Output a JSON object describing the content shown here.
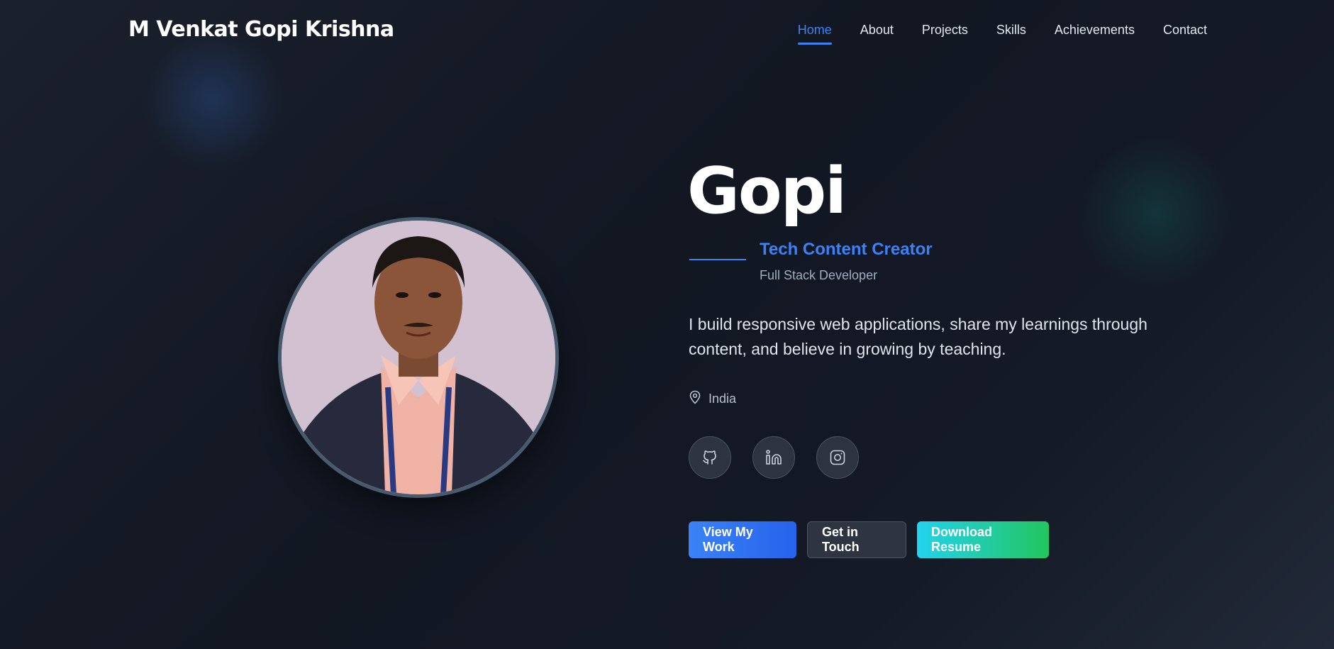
{
  "nav": {
    "brand": "M Venkat Gopi Krishna",
    "links": [
      {
        "label": "Home",
        "active": true
      },
      {
        "label": "About",
        "active": false
      },
      {
        "label": "Projects",
        "active": false
      },
      {
        "label": "Skills",
        "active": false
      },
      {
        "label": "Achievements",
        "active": false
      },
      {
        "label": "Contact",
        "active": false
      }
    ]
  },
  "hero": {
    "name": "Gopi",
    "role_primary": "Tech Content Creator",
    "role_secondary": "Full Stack Developer",
    "bio": "I build responsive web applications, share my learnings through content, and believe in growing by teaching.",
    "location": "India",
    "location_icon": "map-pin-icon",
    "avatar_alt": "Profile photo"
  },
  "socials": [
    {
      "name": "github",
      "icon": "github-icon"
    },
    {
      "name": "linkedin",
      "icon": "linkedin-icon"
    },
    {
      "name": "instagram",
      "icon": "instagram-icon"
    }
  ],
  "buttons": {
    "view_work": "View My Work",
    "get_in_touch": "Get in Touch",
    "download_resume": "Download Resume"
  },
  "colors": {
    "accent": "#3b82f6",
    "background": "#121722",
    "gradient_start": "#22d3ee",
    "gradient_end": "#22c55e"
  }
}
